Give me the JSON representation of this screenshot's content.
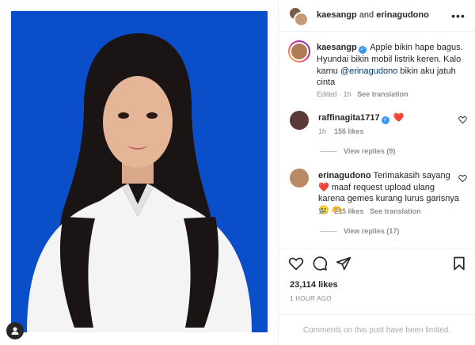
{
  "header": {
    "user1": "kaesangp",
    "conjunction": "and",
    "user2": "erinagudono",
    "more_label": "•••"
  },
  "caption": {
    "username": "kaesangp",
    "text_before_mention": "Apple bikin hape bagus. Hyundai bikin mobil listrik keren. Kalo kamu ",
    "mention": "@erinagudono",
    "text_after_mention": " bikin aku jatuh cinta",
    "edited": "Edited",
    "time": "1h",
    "see_translation": "See translation"
  },
  "comments": [
    {
      "username": "raffinagita1717",
      "text": "",
      "emoji": "❤️",
      "time": "1h",
      "likes": "156 likes",
      "view_replies": "View replies (9)"
    },
    {
      "username": "erinagudono",
      "text": "Terimakasih sayang",
      "text2": "maaf request upload ulang karena gemes kurang lurus garisnya",
      "emoji": "❤️",
      "emoji2": "🥲",
      "emoji3": "🫶",
      "time": "1h",
      "likes": "215 likes",
      "see_translation": "See translation",
      "view_replies": "View replies (17)"
    }
  ],
  "footer": {
    "likes": "23,114 likes",
    "time_ago": "1 HOUR AGO",
    "comments_limited": "Comments on this post have been limited."
  },
  "colors": {
    "photo_background": "#0a4fc9",
    "verified_badge": "#3897f0",
    "mention": "#00376b",
    "heart": "#ed4956"
  }
}
